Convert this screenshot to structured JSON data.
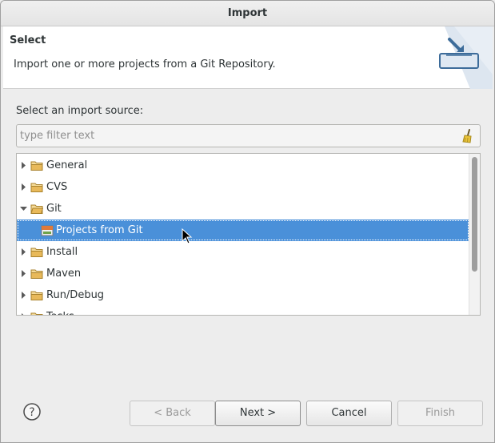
{
  "window": {
    "title": "Import"
  },
  "header": {
    "title": "Select",
    "description": "Import one or more projects from a Git Repository.",
    "art_icon": "import-wizard-icon"
  },
  "source": {
    "label": "Select an import source:",
    "filter_placeholder": "type filter text",
    "filter_value": "",
    "clear_icon": "broom-clear-icon"
  },
  "tree": {
    "items": [
      {
        "label": "General",
        "expanded": false,
        "icon": "folder-icon"
      },
      {
        "label": "CVS",
        "expanded": false,
        "icon": "folder-icon"
      },
      {
        "label": "Git",
        "expanded": true,
        "icon": "folder-open-icon"
      },
      {
        "label": "Projects from Git",
        "child": true,
        "selected": true,
        "icon": "git-projects-icon"
      },
      {
        "label": "Install",
        "expanded": false,
        "icon": "folder-icon"
      },
      {
        "label": "Maven",
        "expanded": false,
        "icon": "folder-icon"
      },
      {
        "label": "Run/Debug",
        "expanded": false,
        "icon": "folder-icon"
      },
      {
        "label": "Tasks",
        "expanded": false,
        "icon": "folder-icon"
      }
    ]
  },
  "buttons": {
    "help_icon": "help-icon",
    "back": "< Back",
    "next": "Next >",
    "cancel": "Cancel",
    "finish": "Finish"
  },
  "colors": {
    "selection": "#4a90d9",
    "folder": "#e8b95a",
    "header_bg": "#ffffff",
    "dialog_bg": "#ededed"
  }
}
